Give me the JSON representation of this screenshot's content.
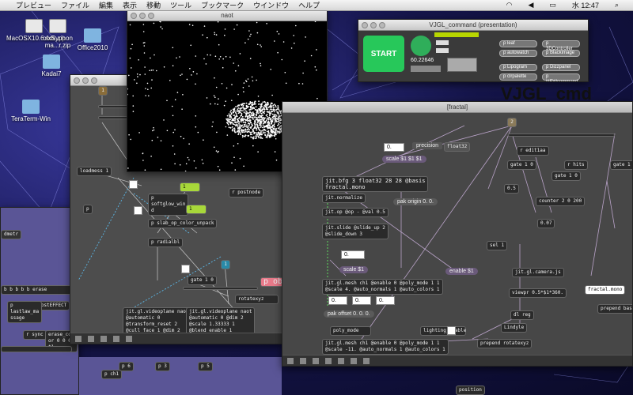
{
  "menubar": {
    "items": [
      "プレビュー",
      "ファイル",
      "編集",
      "表示",
      "移動",
      "ツール",
      "ブックマーク",
      "ウインドウ",
      "ヘルプ"
    ],
    "clock": "水 12:47"
  },
  "desktop_icons": [
    {
      "label": "MacOSX10.6.sdk.zip"
    },
    {
      "label": "ofxSyphon ma...r.zip"
    },
    {
      "label": "Office2010"
    },
    {
      "label": "Kadai7"
    },
    {
      "label": "TeraTerm-Win"
    }
  ],
  "naot_window": {
    "title": "naot"
  },
  "vjgl_window": {
    "title": "VJGL_command (presentation)",
    "start_label": "START",
    "fps_value": "60.22646",
    "buttons": [
      "p leaf",
      "p autowatch",
      "p Lipogram",
      "p clrpalette",
      "p 3DController",
      "p Blackimage",
      "p Dizzpanel",
      "p NEWcommand"
    ]
  },
  "big_title": "VJGL_cmd",
  "fractal_window": {
    "title": "[fractal]",
    "objects": {
      "precision_label": "precision",
      "precision_value": "float32",
      "scale_msg": "scale $1 $1 $1",
      "jitbfg": "jit.bfg 3 float32 28 28 @basis\nfractal.mono",
      "pak_origin": "pak origin 0. 0.",
      "jit_normalize": "jit.normalize",
      "jit_op": "jit.op @op - @val 0.5",
      "jit_slide": "jit.slide @slide_up 2\n@slide_down 3",
      "scale_msg2": "scale $1",
      "enable_msg": "enable $1",
      "gl_mesh1": "jit.gl.mesh ch1 @enable 0 @poly_mode 1 1\n@scale 4. @auto_normals 1 @auto_colors 1",
      "pak_offset": "pak offset 0. 0. 0.",
      "poly_mode": "poly_mode",
      "lighting_enable": "lighting_enable",
      "gl_mesh2": "jit.gl.mesh ch1 @enable 0 @poly_mode 1 1\n@scale -11. @auto_normals 1 @auto_colors 1",
      "counter": "counter 2 0 200",
      "fractal_mono_menu": "fractal.mono",
      "prepend_basis": "prepend basis",
      "prepend_rotatexyz": "prepend rotatexyz",
      "jit_camera": "jit.gl.camera.js",
      "viewpr": "viewpr 0.5*$1*360.",
      "lindyle": "Lindyle",
      "gate1": "gate 1 0",
      "gate2": "gate 1 0",
      "gate3": "gate 1 0",
      "edit1": "r edit1aa",
      "hits": "r hits",
      "val1": "0.5",
      "val2": "0.07",
      "num1": "0.",
      "num2": "0.",
      "num3": "0.",
      "num4": "0.",
      "num5": "0.",
      "sel1": "sel 1",
      "reg": "dl reg",
      "badge": "2"
    }
  },
  "patcher_window": {
    "objects": {
      "loadmess": "loadmess 1",
      "p_softglow": "p\nsoftglow_win\nd",
      "p_slab": "p slab_op_color_unpack",
      "p_radialbl": "p radialbl",
      "gate": "gate 1 0",
      "p_obje": "p obje",
      "rotatexyz": "rotatexyz",
      "videoplane1": "jit.gl.videoplane naot\n@automatic 0\n@transform_reset 2\n@cull_face 1 @dim 2\n@blend_enable 1\n@depth_enable 0",
      "videoplane2": "jit.gl.videoplane naot\n@automatic 0 @dim 2\n@scale 1.33333 1\n@blend_enable 1\n@depth_enable 1\n@rotatexyz 180 180",
      "postnode": "r postnode",
      "flag1": "1",
      "flag2": "1",
      "badge1": "1",
      "badge2": "1",
      "p": "p"
    }
  },
  "left_window": {
    "objects": {
      "dmetr": "dmetr",
      "erase": "b b b b b erase",
      "posteffect": "p postEFFECT",
      "lastlaw": "p\nlastlaw_ma\nssage",
      "sync": "r sync",
      "erase_col": "erase_col\nor 0 0 0\n$1",
      "p6": "p 6",
      "p3": "p 3",
      "p5": "p 5",
      "ch1": "p ch1"
    }
  },
  "position_msg": "position"
}
